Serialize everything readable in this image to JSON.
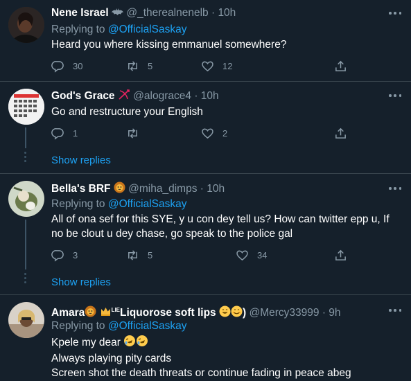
{
  "tweets": [
    {
      "name": "Nene Israel",
      "handle": "@_therealnenelb",
      "time": "10h",
      "replying_label": "Replying to",
      "replying_to": "@OfficialSaskay",
      "text": "Heard you where kissing emmanuel somewhere?",
      "replies": "30",
      "retweets": "5",
      "likes": "12"
    },
    {
      "name": "God's Grace",
      "handle": "@alograce4",
      "time": "10h",
      "text": "Go and restructure your English",
      "replies": "1",
      "retweets": "",
      "likes": "2",
      "show_replies": "Show replies"
    },
    {
      "name": "Bella's BRF",
      "handle": "@miha_dimps",
      "time": "10h",
      "replying_label": "Replying to",
      "replying_to": "@OfficialSaskay",
      "text": "All of ona sef for this SYE, y u con dey tell us? How can twitter epp u, If no be clout u dey chase, go speak to the police gal",
      "replies": "3",
      "retweets": "5",
      "likes": "34",
      "show_replies": "Show replies"
    },
    {
      "name_a": "Amara",
      "name_b": "Liquorose soft lips",
      "name_lie": "LIE",
      "name_paren": ")",
      "handle": "@Mercy33999",
      "time": "9h",
      "replying_label": "Replying to",
      "replying_to": "@OfficialSaskay",
      "lines": [
        "Kpele my dear",
        "Always playing pity cards",
        "Screen shot the death threats or continue fading in peace abeg"
      ]
    }
  ],
  "separator": "·",
  "icons": [
    "reply-icon",
    "retweet-icon",
    "like-icon",
    "share-icon",
    "more-icon"
  ]
}
